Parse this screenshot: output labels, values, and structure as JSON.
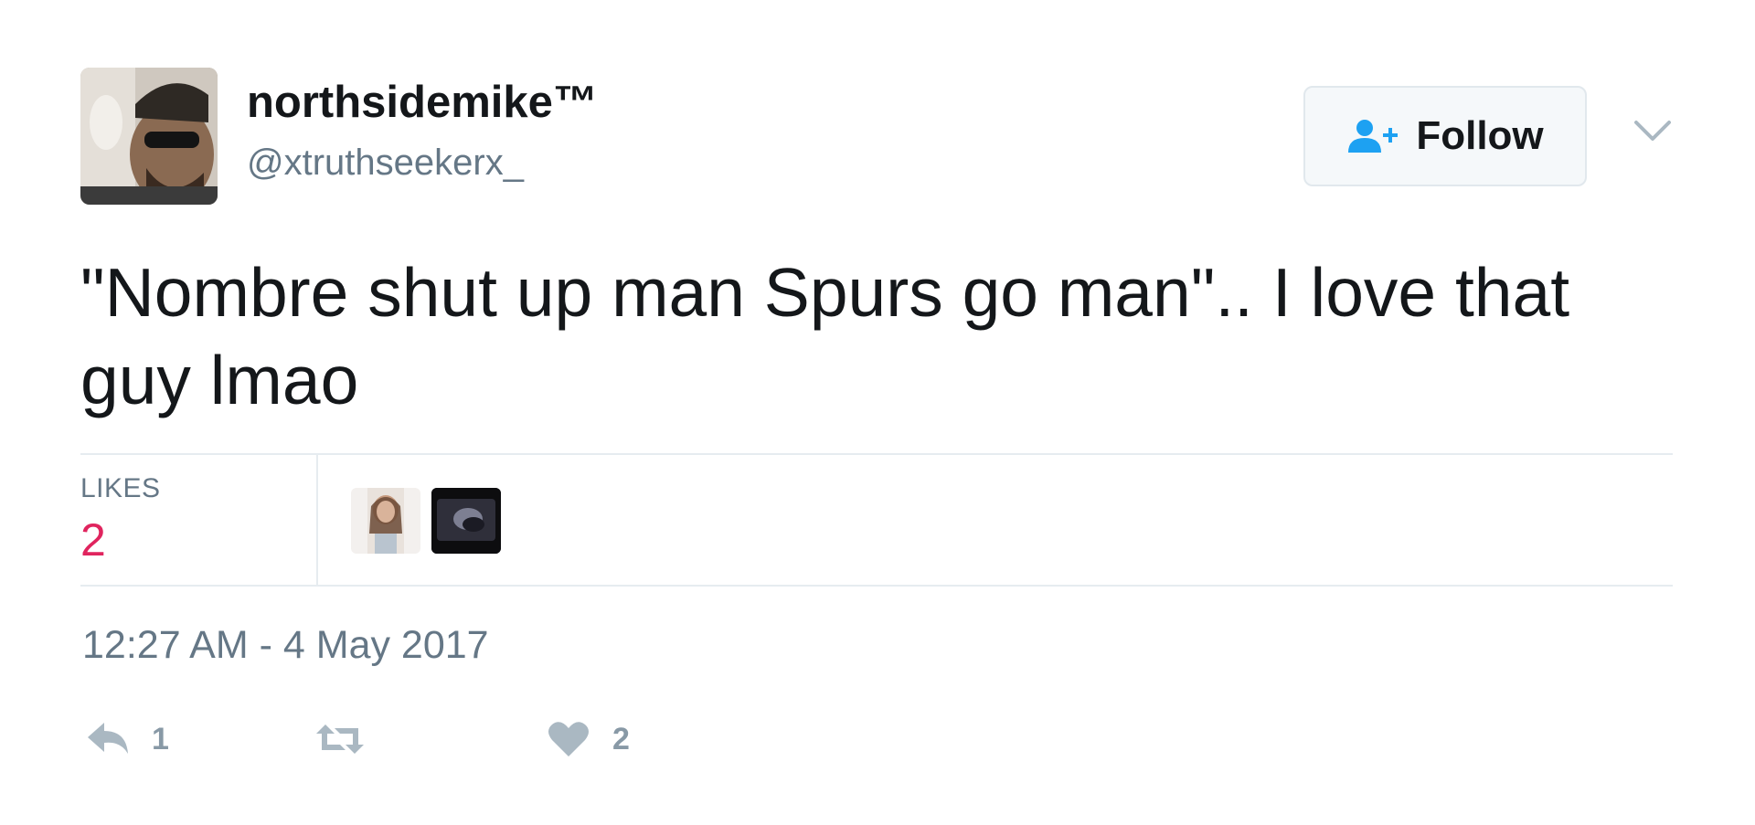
{
  "author": {
    "display_name": "northsidemike™",
    "handle": "@xtruthseekerx_"
  },
  "follow_button": {
    "label": "Follow",
    "icon": "follow-user-icon"
  },
  "menu": {
    "icon": "chevron-down-icon"
  },
  "tweet": {
    "text": "\"Nombre shut up man Spurs go man\".. I love that guy lmao",
    "timestamp": "12:27 AM - 4 May 2017"
  },
  "stats": {
    "likes_label": "LIKES",
    "likes_count": "2",
    "likers": [
      {
        "name": "liker-avatar-1"
      },
      {
        "name": "liker-avatar-2"
      }
    ]
  },
  "actions": {
    "reply": {
      "icon": "reply-icon",
      "count": "1"
    },
    "retweet": {
      "icon": "retweet-icon",
      "count": ""
    },
    "like": {
      "icon": "heart-icon",
      "count": "2"
    }
  },
  "colors": {
    "text_primary": "#14171a",
    "text_secondary": "#657786",
    "likes_count": "#e0245e",
    "follow_icon": "#1da1f2",
    "action_icon": "#aab8c2",
    "divider": "#e6ecf0"
  }
}
